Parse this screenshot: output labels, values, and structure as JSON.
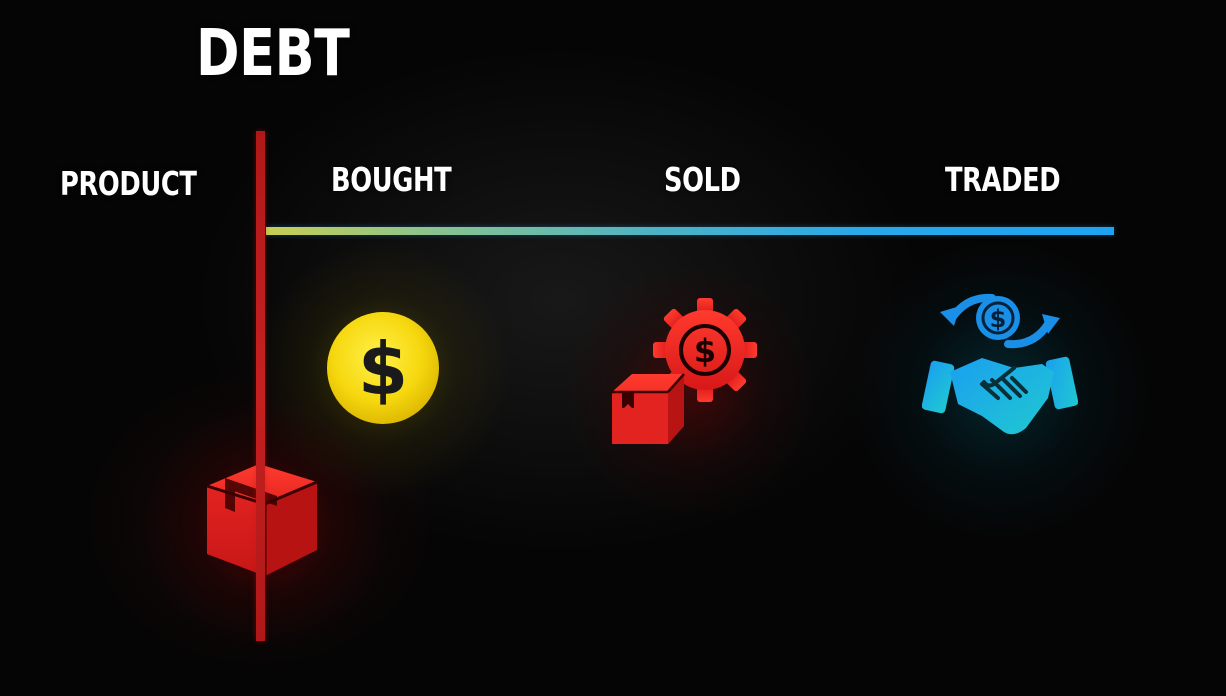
{
  "title": "DEBT",
  "labels": {
    "product": "PRODUCT",
    "bought": "BOUGHT",
    "sold": "SOLD",
    "traded": "TRADED"
  },
  "icons": {
    "bought": "dollar-coin-icon",
    "sold": "box-with-gear-dollar-icon",
    "traded": "handshake-dollar-exchange-icon",
    "product": "package-box-icon"
  },
  "colors": {
    "background": "#050505",
    "text": "#ffffff",
    "vertical_line": "#c52020",
    "timeline_start": "#c8cf52",
    "timeline_end": "#1ea3f2",
    "coin_yellow": "#f2d30c",
    "sold_red": "#e0201f",
    "traded_cyan": "#1fb6e6"
  }
}
